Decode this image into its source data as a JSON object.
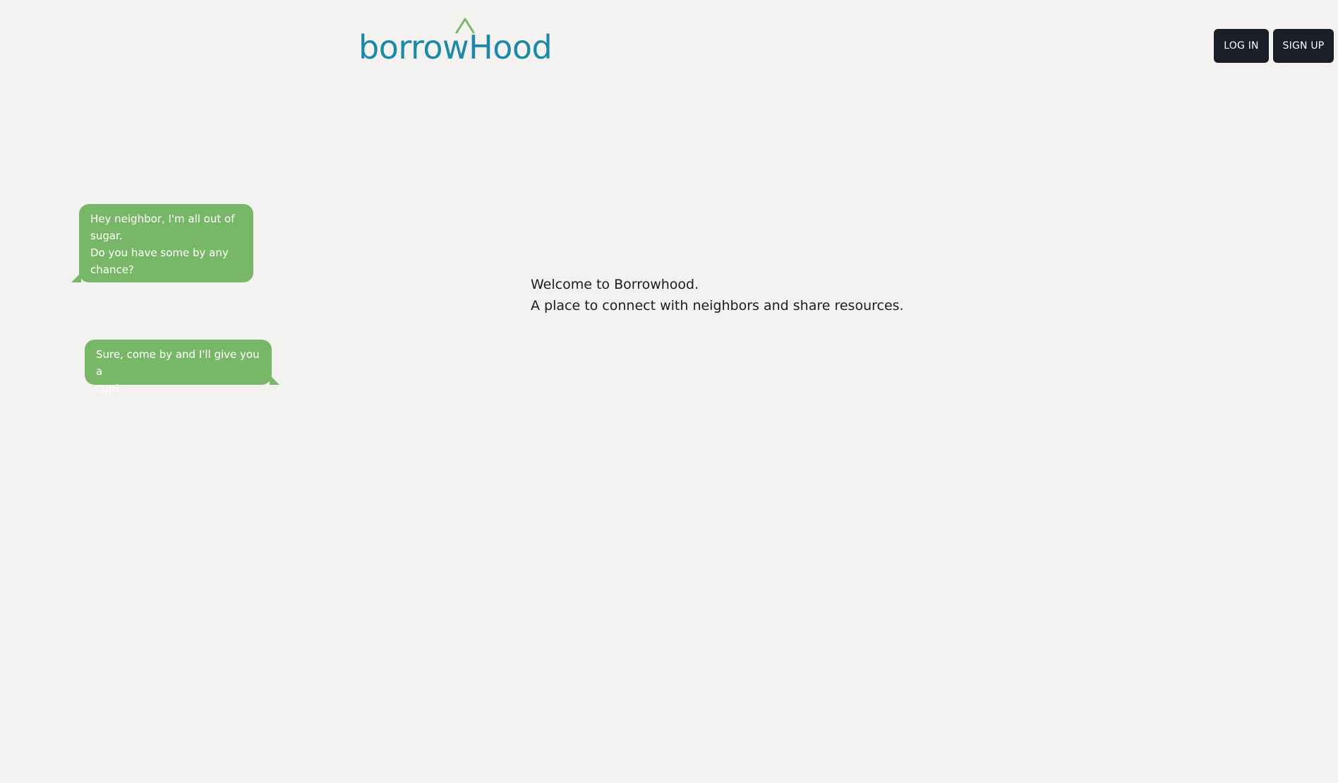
{
  "header": {
    "logo_text": "borrowHood",
    "login_label": "LOG IN",
    "signup_label": "SIGN UP"
  },
  "chat": {
    "message_1_lines": [
      "Hey neighbor, I'm all out of",
      "sugar.",
      "Do you have some by any",
      "chance?"
    ],
    "message_2_lines": [
      "Sure, come by and I'll give you a",
      "cup!"
    ]
  },
  "main": {
    "welcome_line_1": "Welcome to Borrowhood.",
    "welcome_line_2": "A place to connect with neighbors and share resources."
  },
  "colors": {
    "background": "#f4f2f0",
    "logo_text": "#1b8aa6",
    "logo_roof": "#78b767",
    "bubble": "#78b767",
    "button": "#1a1f27"
  },
  "icons": {
    "logo_roof": "house-roof-icon"
  }
}
